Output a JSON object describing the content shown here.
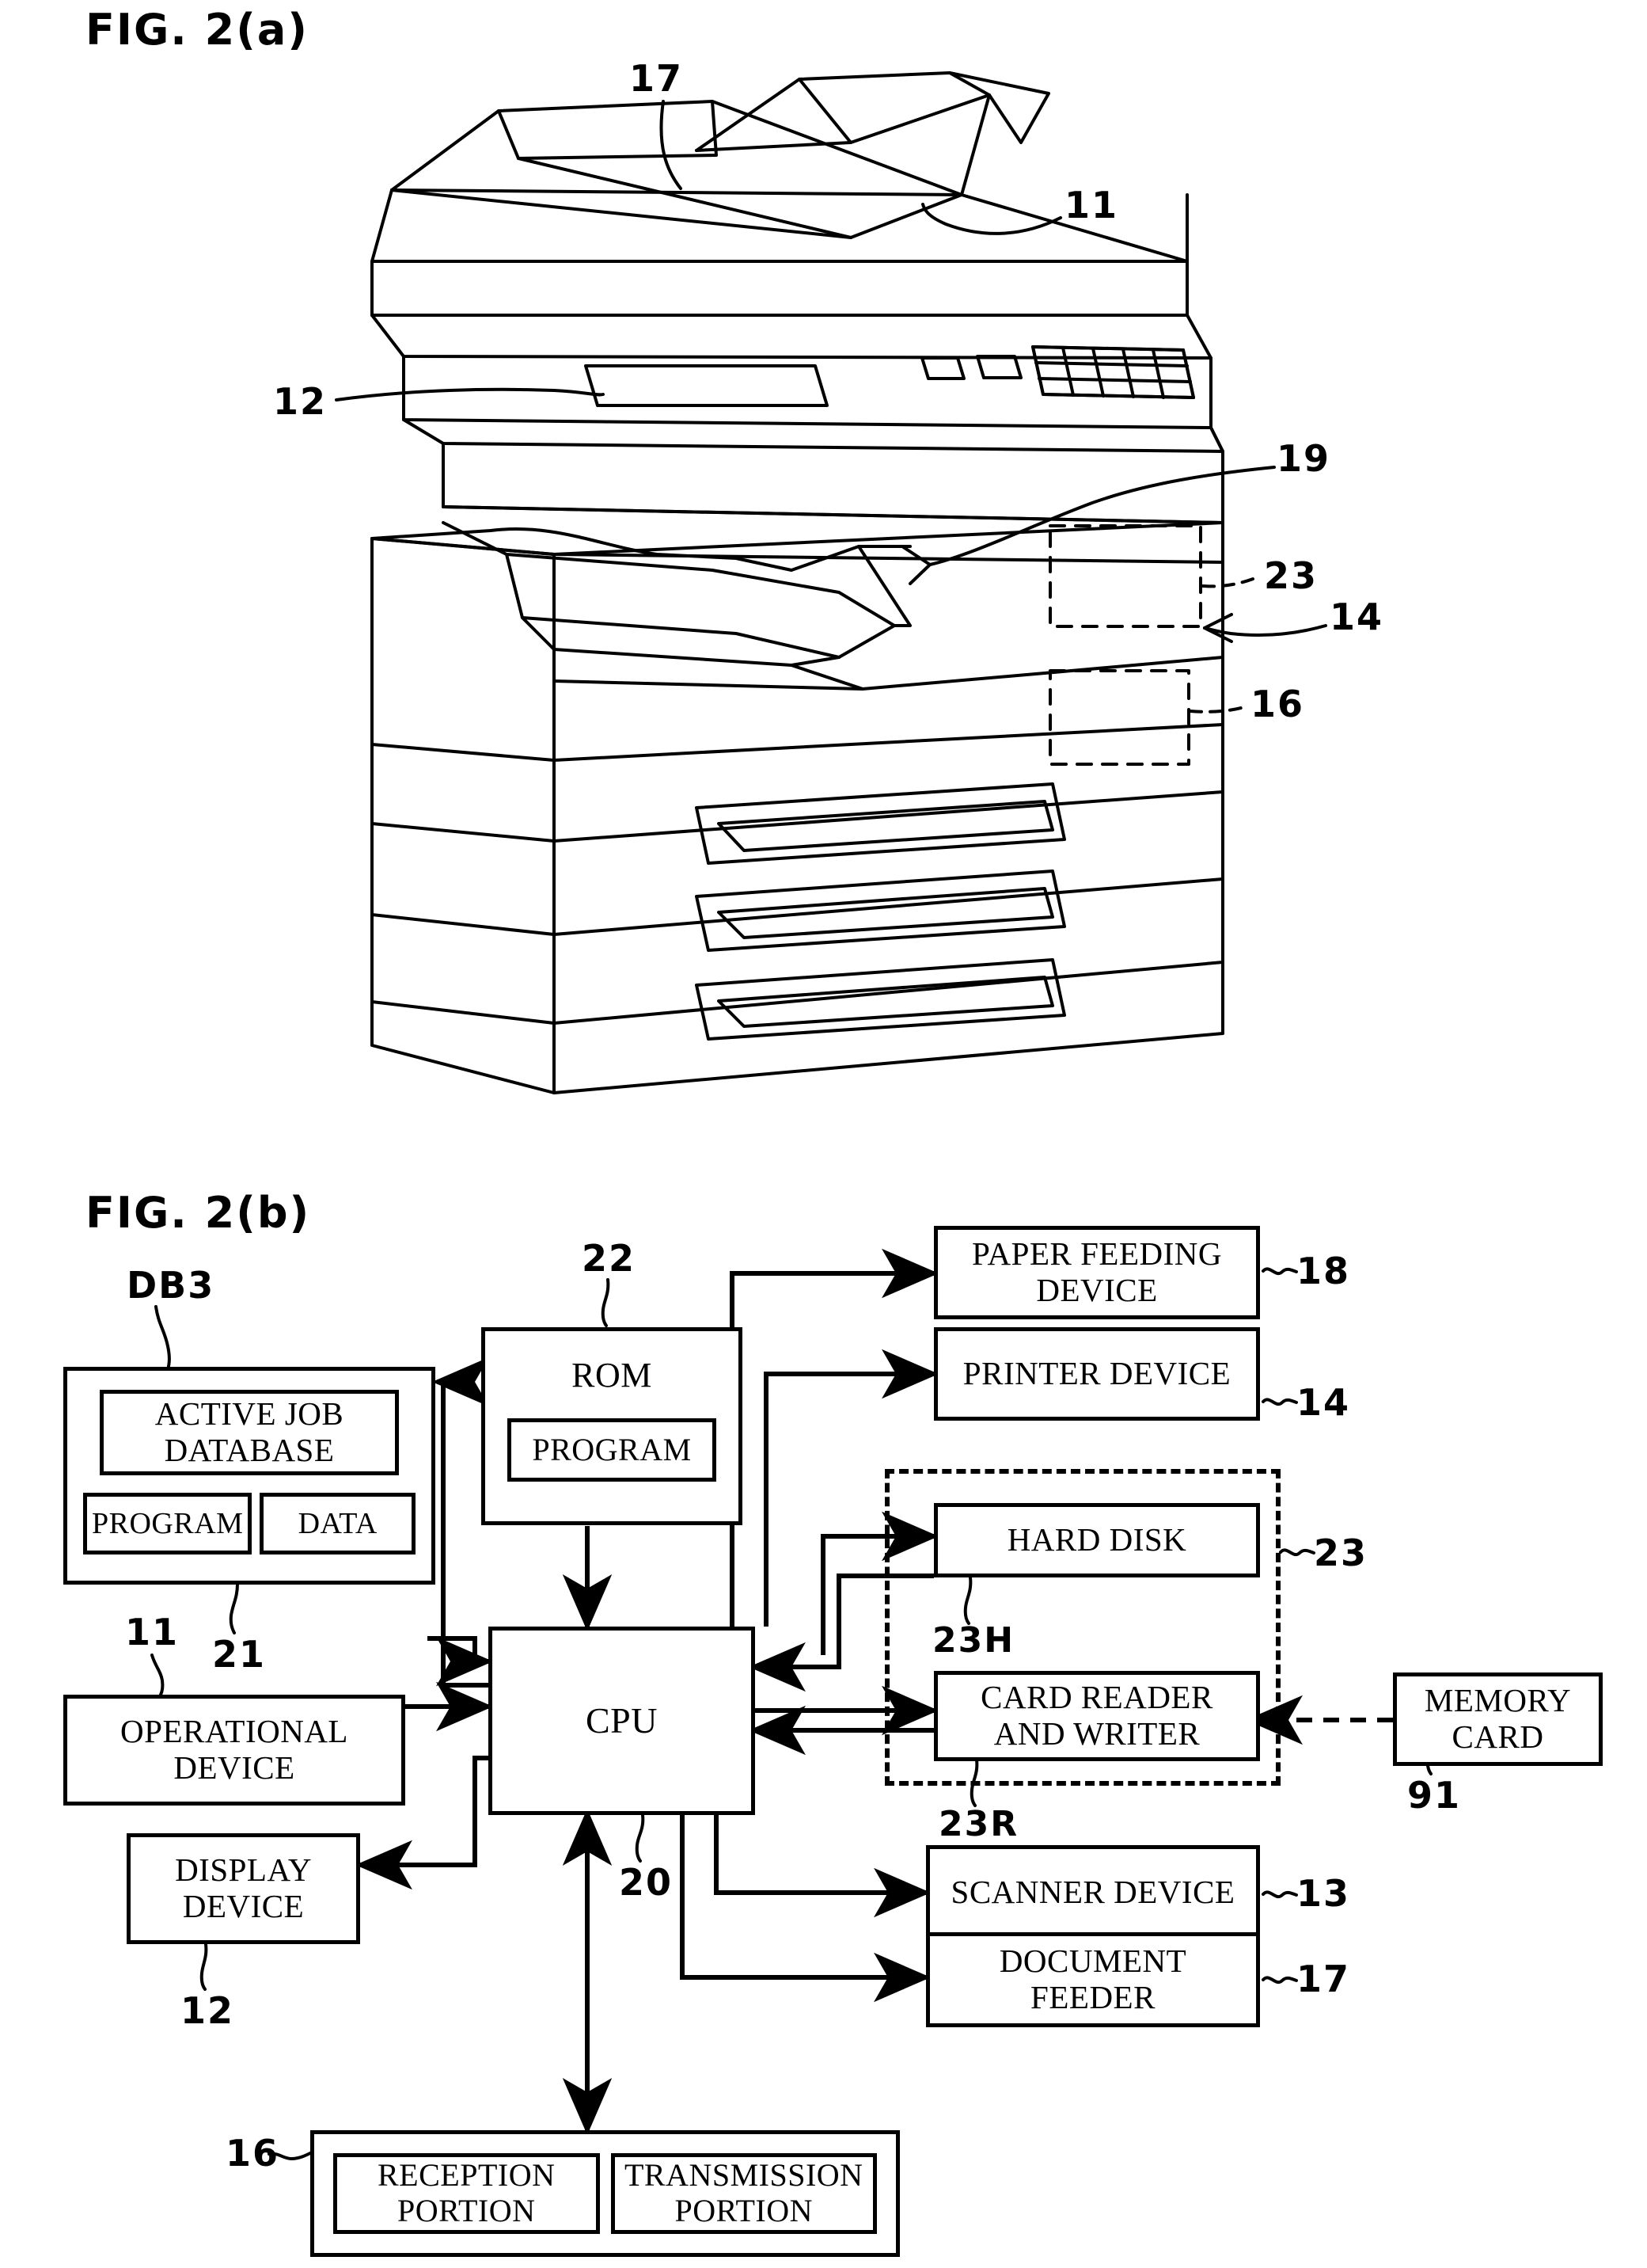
{
  "figures": {
    "fig_a": {
      "caption": "FIG. 2(a)",
      "callouts": [
        {
          "id": "c17",
          "text": "17"
        },
        {
          "id": "c11",
          "text": "11"
        },
        {
          "id": "c12",
          "text": "12"
        },
        {
          "id": "c19",
          "text": "19"
        },
        {
          "id": "c23",
          "text": "23"
        },
        {
          "id": "c14",
          "text": "14"
        },
        {
          "id": "c16",
          "text": "16"
        }
      ]
    },
    "fig_b": {
      "caption": "FIG. 2(b)",
      "blocks": {
        "db3_group_label": "DB3",
        "active_job_database": "ACTIVE JOB DATABASE",
        "ram_program": "PROGRAM",
        "ram_data": "DATA",
        "ram_ref": "21",
        "rom": "ROM",
        "rom_program": "PROGRAM",
        "rom_ref": "22",
        "cpu": "CPU",
        "cpu_ref": "20",
        "operational_device": "OPERATIONAL DEVICE",
        "operational_device_ref": "11",
        "display_device": "DISPLAY DEVICE",
        "display_device_ref": "12",
        "paper_feeding_device": "PAPER FEEDING DEVICE",
        "paper_feeding_device_ref": "18",
        "printer_device": "PRINTER DEVICE",
        "printer_device_ref": "14",
        "hard_disk": "HARD DISK",
        "hard_disk_ref": "23H",
        "card_reader_and_writer": "CARD READER AND WRITER",
        "card_reader_and_writer_ref": "23R",
        "card_group_ref": "23",
        "memory_card": "MEMORY CARD",
        "memory_card_ref": "91",
        "scanner_device": "SCANNER DEVICE",
        "scanner_device_ref": "13",
        "document_feeder": "DOCUMENT FEEDER",
        "document_feeder_ref": "17",
        "reception_portion": "RECEPTION PORTION",
        "transmission_portion": "TRANSMISSION PORTION",
        "comm_group_ref": "16"
      }
    }
  },
  "style": {
    "line_color": "#000000",
    "background": "#ffffff"
  }
}
